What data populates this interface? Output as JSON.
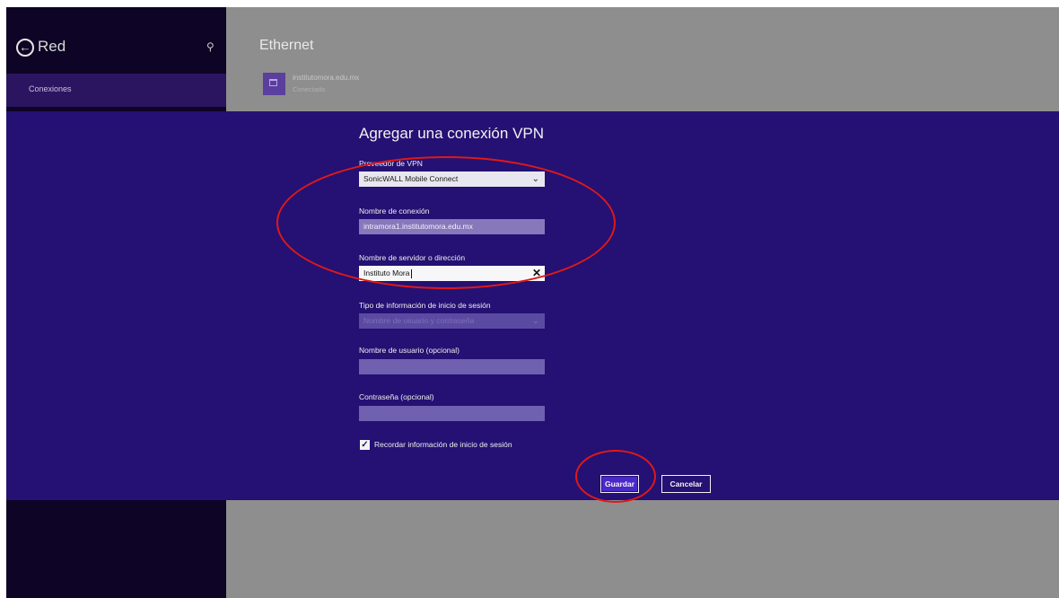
{
  "sidebar": {
    "title": "Red",
    "back_icon": "back-arrow-circle-icon",
    "search_icon": "search-icon",
    "selected_item": "Conexiones"
  },
  "main": {
    "section_title": "Ethernet",
    "network": {
      "name": "institutomora.edu.mx",
      "status": "Conectado",
      "icon": "network-icon"
    }
  },
  "dialog": {
    "title": "Agregar una conexión VPN",
    "provider": {
      "label": "Proveedor de VPN",
      "value": "SonicWALL Mobile Connect"
    },
    "connection_name": {
      "label": "Nombre de conexión",
      "value": "intramora1.institutomora.edu.mx"
    },
    "server": {
      "label": "Nombre de servidor o dirección",
      "value": "Instituto Mora"
    },
    "signin_type": {
      "label": "Tipo de información de inicio de sesión",
      "value": "Nombre de usuario y contraseña"
    },
    "username": {
      "label": "Nombre de usuario (opcional)",
      "value": ""
    },
    "password": {
      "label": "Contraseña (opcional)",
      "value": ""
    },
    "remember": {
      "label": "Recordar información de inicio de sesión",
      "checked": true
    },
    "save_label": "Guardar",
    "cancel_label": "Cancelar"
  },
  "colors": {
    "dialog_background": "#241173",
    "sidebar_background": "#0e0425",
    "annotation": "#e01818"
  }
}
